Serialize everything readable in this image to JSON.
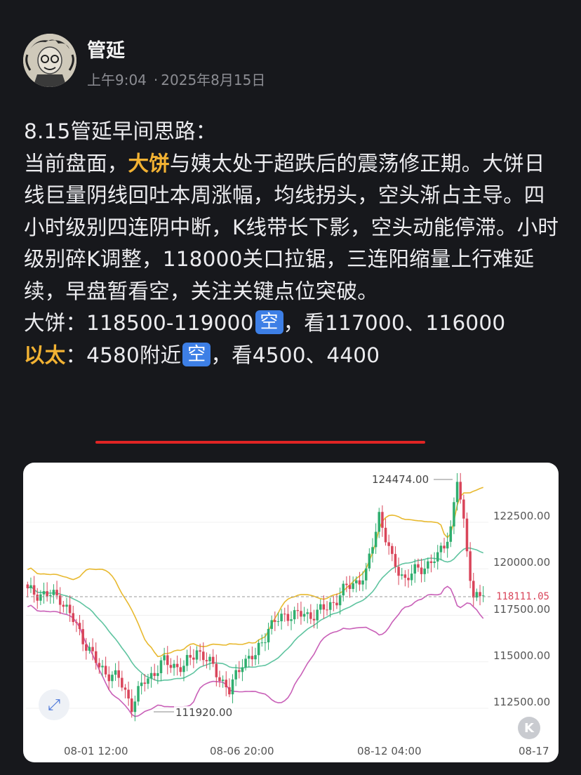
{
  "author": {
    "name": "管延",
    "time": "上午9:04",
    "date": "2025年8月15日"
  },
  "post": {
    "title": "8.15管延早间思路：",
    "p2_before": "当前盘面，",
    "p2_highlight": "大饼",
    "p2_after": "与姨太处于超跌后的震荡修正期。大饼日线巨量阴线回吐本周涨幅，均线拐头，空头渐占主导。四小时级别四连阴中断，K线带长下影，空头动能停滞。小时级别碎K调整，118000关口拉锯，三连阳缩量上行难延续，早盘暂看空，关注关键点位突破。",
    "btc_label": "大饼：",
    "btc_range": "118500-119000",
    "btc_icon": "空",
    "btc_targets": "，看117000、116000",
    "eth_label": "以太",
    "eth_colon": "：",
    "eth_range": "4580附近",
    "eth_icon": "空",
    "eth_targets": "，看4500、4400"
  },
  "chart_data": {
    "type": "candlestick",
    "x_ticks": [
      "08-01 12:00",
      "08-06 20:00",
      "08-12 04:00",
      "08-17"
    ],
    "y_ticks": [
      "122500.00",
      "120000.00",
      "117500.00",
      "115000.00",
      "112500.00"
    ],
    "current_price": "118111.05",
    "high_label": "124474.00",
    "low_label": "111920.00",
    "ylim": [
      110500,
      125500
    ],
    "indicator": "bollinger bands (upper, middle, lower)",
    "colors": {
      "up": "#2fae6f",
      "down": "#d9455a",
      "upper": "#e8b92f",
      "middle": "#5fc4a0",
      "lower": "#c960b8"
    }
  },
  "ui": {
    "expand_icon": "⤢",
    "k_icon": "K"
  }
}
